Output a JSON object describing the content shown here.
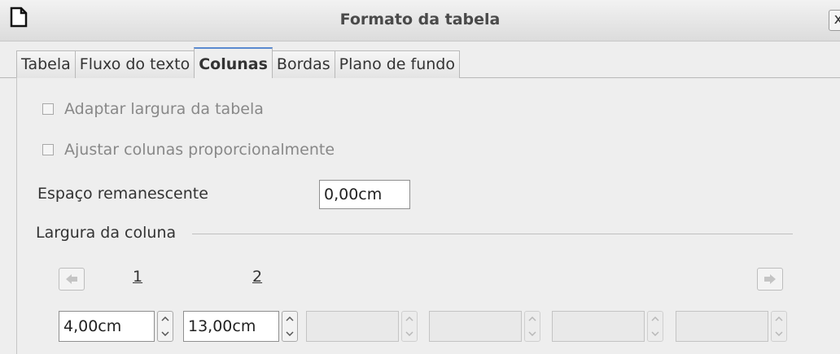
{
  "window": {
    "title": "Formato da tabela",
    "close_glyph": "x"
  },
  "tabs": [
    {
      "label": "Tabela",
      "active": false
    },
    {
      "label": "Fluxo do texto",
      "active": false
    },
    {
      "label": "Colunas",
      "active": true
    },
    {
      "label": "Bordas",
      "active": false
    },
    {
      "label": "Plano de fundo",
      "active": false
    }
  ],
  "options": {
    "adapt_width": {
      "label": "Adaptar largura da tabela",
      "checked": false,
      "enabled": false
    },
    "adjust_columns": {
      "label": "Ajustar colunas proporcionalmente",
      "checked": false,
      "enabled": false
    }
  },
  "remaining_space": {
    "label": "Espaço remanescente",
    "value": "0,00cm"
  },
  "column_width": {
    "section_label": "Largura da coluna",
    "column_numbers": [
      "1",
      "2"
    ],
    "fields": [
      {
        "value": "4,00cm",
        "enabled": true
      },
      {
        "value": "13,00cm",
        "enabled": true
      },
      {
        "value": "",
        "enabled": false
      },
      {
        "value": "",
        "enabled": false
      },
      {
        "value": "",
        "enabled": false
      },
      {
        "value": "",
        "enabled": false
      }
    ]
  },
  "icons": {
    "doc": "document-icon",
    "left": "arrow-left-icon",
    "right": "arrow-right-icon",
    "spin_up": "spin-up-icon",
    "spin_down": "spin-down-icon"
  }
}
